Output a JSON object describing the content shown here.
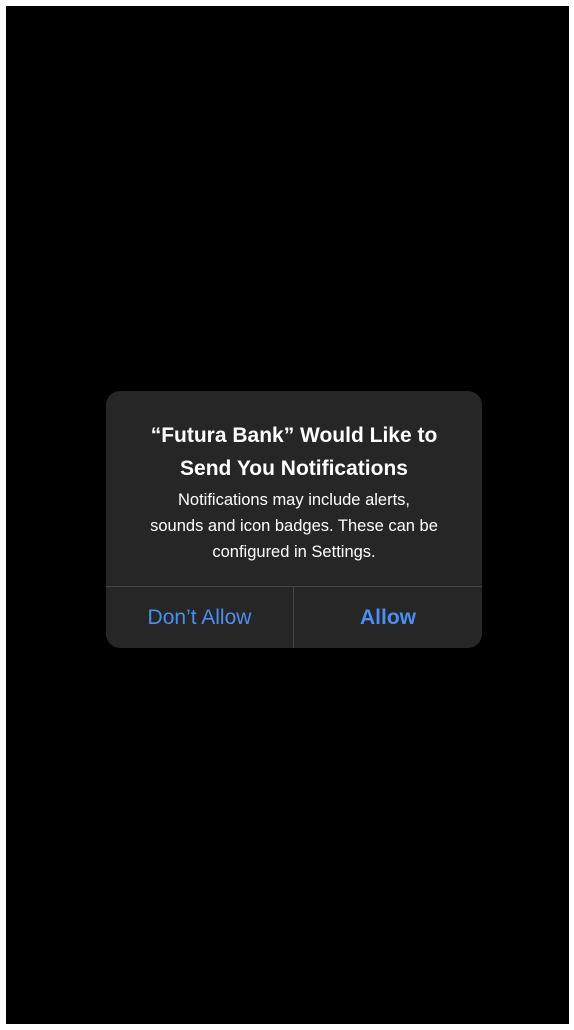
{
  "alert": {
    "title": "“Futura Bank” Would Like to\nSend You Notifications",
    "message": "Notifications may include alerts,\nsounds and icon badges. These can be\nconfigured in Settings.",
    "buttons": {
      "dont_allow": "Don’t Allow",
      "allow": "Allow"
    }
  },
  "colors": {
    "screen_background": "#000000",
    "alert_background": "#262626",
    "button_text": "#4a8ef1",
    "divider": "#444446"
  }
}
